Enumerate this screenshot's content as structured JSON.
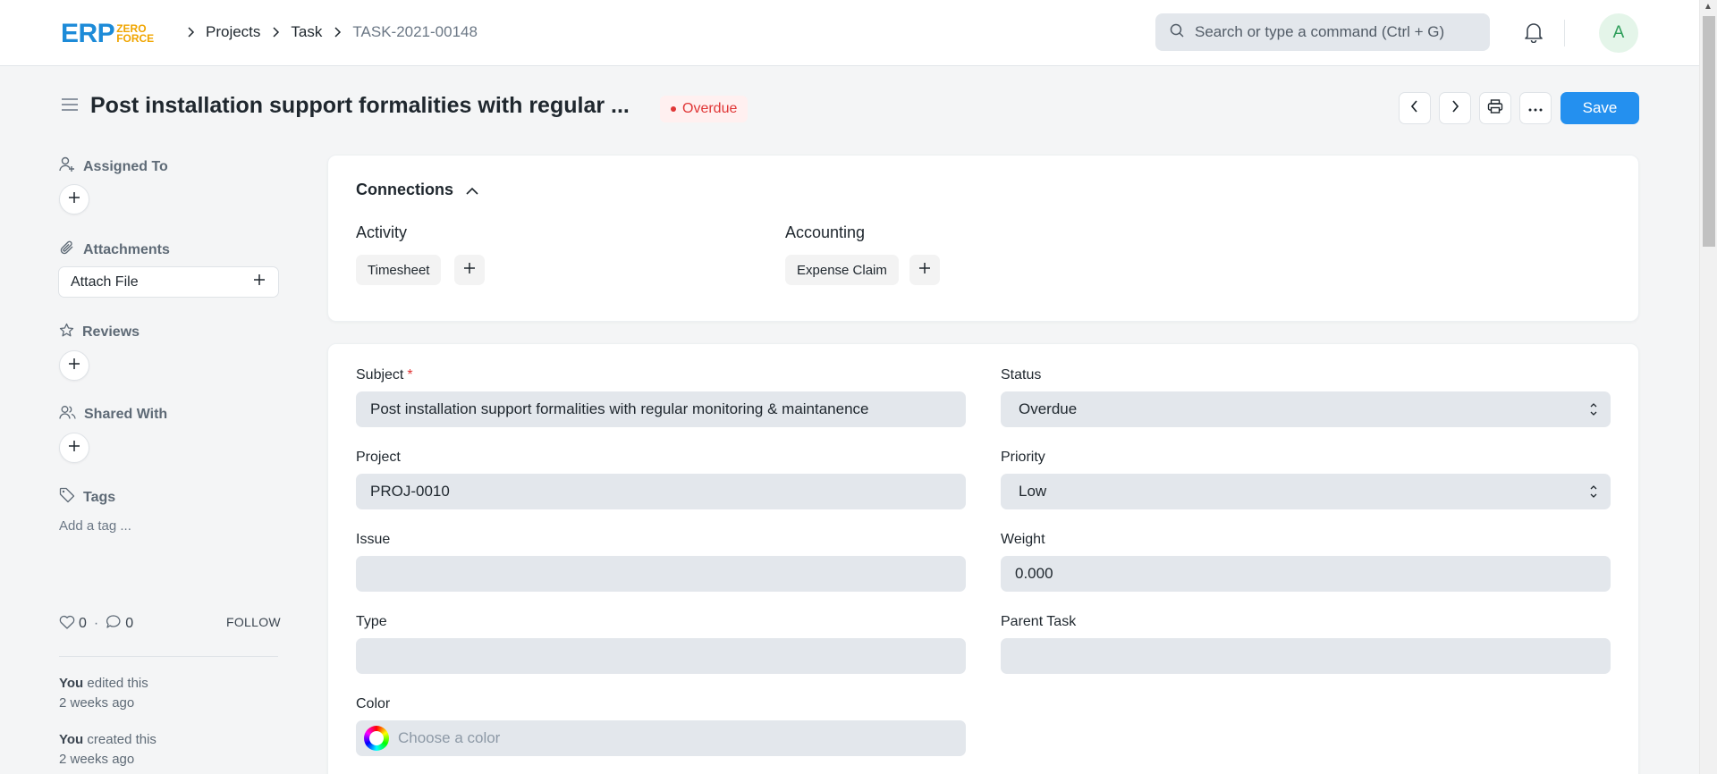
{
  "navbar": {
    "logo": {
      "main": "ERP",
      "top": "ZERO",
      "bottom": "FORCE"
    },
    "breadcrumbs": [
      "Projects",
      "Task",
      "TASK-2021-00148"
    ],
    "search_placeholder": "Search or type a command (Ctrl + G)",
    "avatar_initial": "A"
  },
  "page": {
    "title": "Post installation support formalities with regular ...",
    "status_indicator": "Overdue",
    "save_label": "Save"
  },
  "sidebar": {
    "assigned_to": "Assigned To",
    "attachments": "Attachments",
    "attach_file": "Attach File",
    "reviews": "Reviews",
    "shared_with": "Shared With",
    "tags": "Tags",
    "add_tag": "Add a tag ...",
    "likes": "0",
    "comments": "0",
    "follow": "FOLLOW",
    "timeline": [
      {
        "user": "You",
        "action": "edited this",
        "time": "2 weeks ago"
      },
      {
        "user": "You",
        "action": "created this",
        "time": "2 weeks ago"
      }
    ]
  },
  "connections": {
    "title": "Connections",
    "groups": [
      {
        "label": "Activity",
        "items": [
          "Timesheet"
        ]
      },
      {
        "label": "Accounting",
        "items": [
          "Expense Claim"
        ]
      }
    ]
  },
  "form": {
    "subject": {
      "label": "Subject",
      "value": "Post installation support formalities with regular monitoring & maintanence"
    },
    "status": {
      "label": "Status",
      "value": "Overdue"
    },
    "project": {
      "label": "Project",
      "value": "PROJ-0010"
    },
    "priority": {
      "label": "Priority",
      "value": "Low"
    },
    "issue": {
      "label": "Issue",
      "value": ""
    },
    "weight": {
      "label": "Weight",
      "value": "0.000"
    },
    "type": {
      "label": "Type",
      "value": ""
    },
    "parent_task": {
      "label": "Parent Task",
      "value": ""
    },
    "color": {
      "label": "Color",
      "placeholder": "Choose a color"
    }
  },
  "colors": {
    "primary": "#2490ef",
    "danger": "#e03636",
    "field_bg": "#e3e7ec",
    "page_bg": "#f4f5f6"
  }
}
